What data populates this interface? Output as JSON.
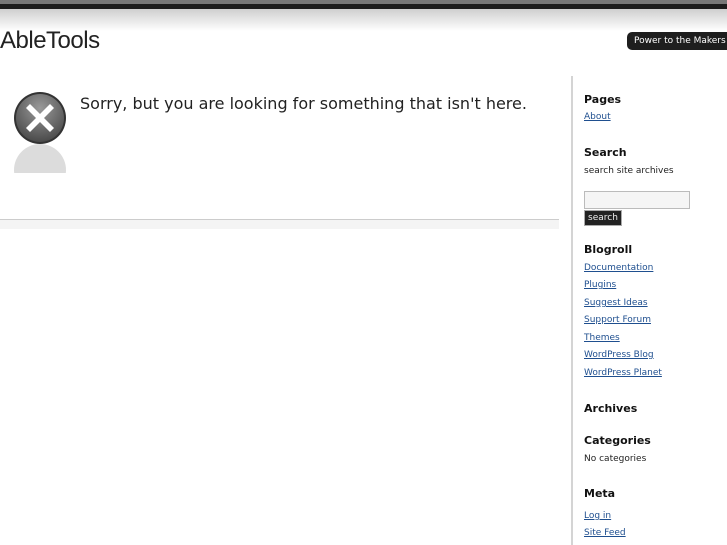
{
  "header": {
    "site_title": "AbleTools",
    "tagline": "Power to the Makers!"
  },
  "main": {
    "error_icon": "error-x-icon",
    "message": "Sorry, but you are looking for something that isn't here."
  },
  "sidebar": {
    "pages_heading": "Pages",
    "pages": [
      "About"
    ],
    "search_heading": "Search",
    "search_label": "search site archives",
    "search_value": "",
    "search_button": "search",
    "blogroll_heading": "Blogroll",
    "blogroll": [
      "Documentation",
      "Plugins",
      "Suggest Ideas",
      "Support Forum",
      "Themes",
      "WordPress Blog",
      "WordPress Planet"
    ],
    "archives_heading": "Archives",
    "categories_heading": "Categories",
    "categories_text": "No categories",
    "meta_heading": "Meta",
    "meta": [
      "Log in",
      "Site Feed"
    ]
  }
}
